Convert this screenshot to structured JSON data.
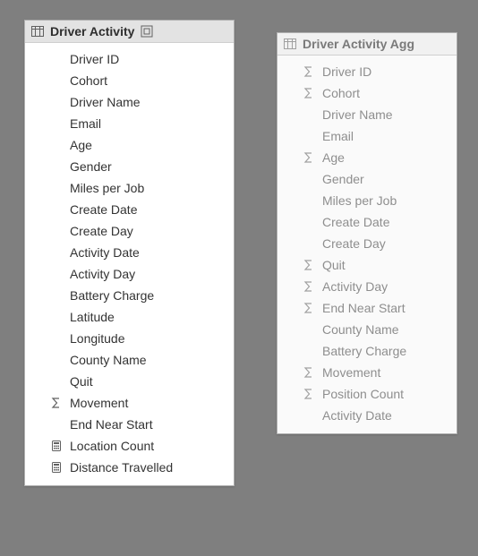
{
  "panels": {
    "activity": {
      "title": "Driver Activity",
      "fields": [
        {
          "icon": "none",
          "label": "Driver ID"
        },
        {
          "icon": "none",
          "label": "Cohort"
        },
        {
          "icon": "none",
          "label": "Driver Name"
        },
        {
          "icon": "none",
          "label": "Email"
        },
        {
          "icon": "none",
          "label": "Age"
        },
        {
          "icon": "none",
          "label": "Gender"
        },
        {
          "icon": "none",
          "label": "Miles per Job"
        },
        {
          "icon": "none",
          "label": "Create Date"
        },
        {
          "icon": "none",
          "label": "Create Day"
        },
        {
          "icon": "none",
          "label": "Activity Date"
        },
        {
          "icon": "none",
          "label": "Activity Day"
        },
        {
          "icon": "none",
          "label": "Battery Charge"
        },
        {
          "icon": "none",
          "label": "Latitude"
        },
        {
          "icon": "none",
          "label": "Longitude"
        },
        {
          "icon": "none",
          "label": "County Name"
        },
        {
          "icon": "none",
          "label": "Quit"
        },
        {
          "icon": "sum",
          "label": "Movement"
        },
        {
          "icon": "none",
          "label": "End Near Start"
        },
        {
          "icon": "calc",
          "label": "Location Count"
        },
        {
          "icon": "calc",
          "label": "Distance Travelled"
        }
      ]
    },
    "agg": {
      "title": "Driver Activity Agg",
      "fields": [
        {
          "icon": "sum",
          "label": "Driver ID"
        },
        {
          "icon": "sum",
          "label": "Cohort"
        },
        {
          "icon": "none",
          "label": "Driver Name"
        },
        {
          "icon": "none",
          "label": "Email"
        },
        {
          "icon": "sum",
          "label": "Age"
        },
        {
          "icon": "none",
          "label": "Gender"
        },
        {
          "icon": "none",
          "label": "Miles per Job"
        },
        {
          "icon": "none",
          "label": "Create Date"
        },
        {
          "icon": "none",
          "label": "Create Day"
        },
        {
          "icon": "sum",
          "label": "Quit"
        },
        {
          "icon": "sum",
          "label": "Activity Day"
        },
        {
          "icon": "sum",
          "label": "End Near Start"
        },
        {
          "icon": "none",
          "label": "County Name"
        },
        {
          "icon": "none",
          "label": "Battery Charge"
        },
        {
          "icon": "sum",
          "label": "Movement"
        },
        {
          "icon": "sum",
          "label": "Position Count"
        },
        {
          "icon": "none",
          "label": "Activity Date"
        }
      ]
    }
  }
}
